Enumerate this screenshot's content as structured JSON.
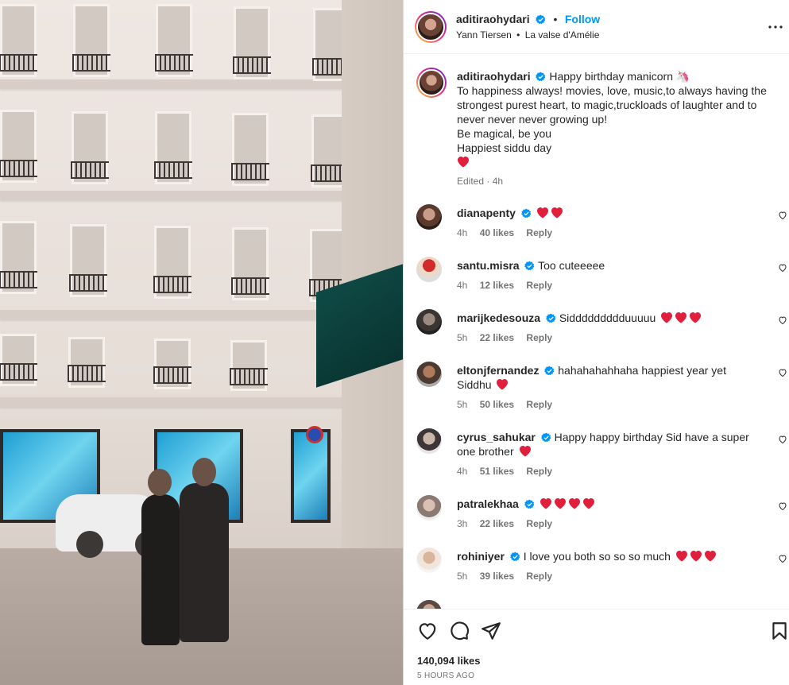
{
  "post": {
    "author": "aditiraohydari",
    "follow_label": "Follow",
    "separator": "•",
    "audio_artist": "Yann Tiersen",
    "audio_track": "La valse d'Amélie",
    "caption_lines": [
      "Happy birthday manicorn 🦄",
      "To happiness always! movies, love, music,to always having the strongest purest heart, to magic,truckloads of laughter and to never never never growing up!",
      "Be magical, be you",
      "Happiest siddu day"
    ],
    "caption_meta": "Edited · 4h",
    "total_likes": "140,094 likes",
    "posted_ago": "5 HOURS AGO"
  },
  "comments": [
    {
      "user": "dianapenty",
      "text": "",
      "hearts": 2,
      "time": "4h",
      "likes": "40 likes",
      "reply": "Reply"
    },
    {
      "user": "santu.misra",
      "text": "Too cuteeeee",
      "hearts": 0,
      "time": "4h",
      "likes": "12 likes",
      "reply": "Reply"
    },
    {
      "user": "marijkedesouza",
      "text": "Siddddddddduuuuu",
      "hearts": 3,
      "time": "5h",
      "likes": "22 likes",
      "reply": "Reply"
    },
    {
      "user": "eltonjfernandez",
      "text": "hahahahahhaha happiest year yet Siddhu",
      "hearts": 1,
      "time": "5h",
      "likes": "50 likes",
      "reply": "Reply"
    },
    {
      "user": "cyrus_sahukar",
      "text": "Happy happy birthday Sid have a super one brother",
      "hearts": 1,
      "time": "4h",
      "likes": "51 likes",
      "reply": "Reply"
    },
    {
      "user": "patralekhaa",
      "text": "",
      "hearts": 4,
      "time": "3h",
      "likes": "22 likes",
      "reply": "Reply"
    },
    {
      "user": "rohiniyer",
      "text": "I love you both so so so much",
      "hearts": 3,
      "time": "5h",
      "likes": "39 likes",
      "reply": "Reply"
    }
  ],
  "icons": {
    "verified": "verified-badge-icon",
    "more": "more-options-icon",
    "like": "heart-outline-icon",
    "comment": "comment-bubble-icon",
    "share": "paper-plane-icon",
    "save": "bookmark-icon",
    "heart_emoji": "red-heart-emoji"
  },
  "colors": {
    "link": "#0095f6",
    "text": "#262626",
    "muted": "#737373",
    "heart": "#e01f3d",
    "verified": "#0095f6"
  }
}
